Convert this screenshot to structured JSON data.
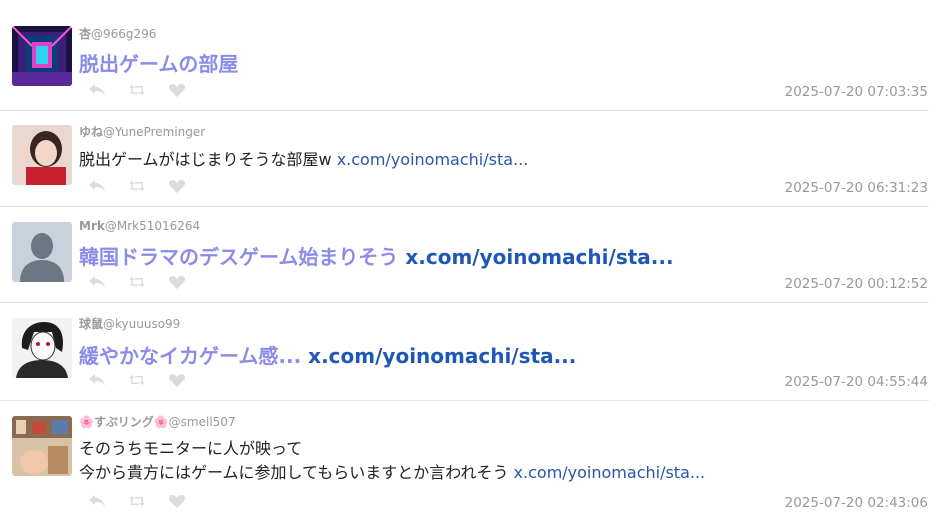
{
  "posts": [
    {
      "name": "杏",
      "handle": "@966g296",
      "text": "脱出ゲームの部屋",
      "link": "",
      "timestamp": "2025-07-20 07:03:35"
    },
    {
      "name": "ゆね",
      "handle": "@YunePreminger",
      "text": "脱出ゲームがはじまりそうな部屋w",
      "link": "x.com/yoinomachi/sta...",
      "timestamp": "2025-07-20 06:31:23"
    },
    {
      "name": "Mrk",
      "handle": "@Mrk51016264",
      "text": "韓国ドラマのデスゲーム始まりそう",
      "link": "x.com/yoinomachi/sta...",
      "timestamp": "2025-07-20 00:12:52"
    },
    {
      "name": "球鼠",
      "handle": "@kyuuuso99",
      "text": "緩やかなイカゲーム感...",
      "link": "x.com/yoinomachi/sta...",
      "timestamp": "2025-07-20 04:55:44"
    },
    {
      "name": "🌸すぷリング🌸",
      "handle": "@smell507",
      "line1": "そのうちモニターに人が映って",
      "line2": "今から貴方にはゲームに参加してもらいますとか言われそう",
      "link": "x.com/yoinomachi/sta...",
      "timestamp": "2025-07-20 02:43:06"
    }
  ],
  "colors": {
    "highlight_text": "#8b8bea",
    "link": "#1f58b4",
    "muted": "#999999",
    "icon": "#dcdcdc"
  },
  "icons": [
    "reply-icon",
    "retweet-icon",
    "like-icon"
  ]
}
